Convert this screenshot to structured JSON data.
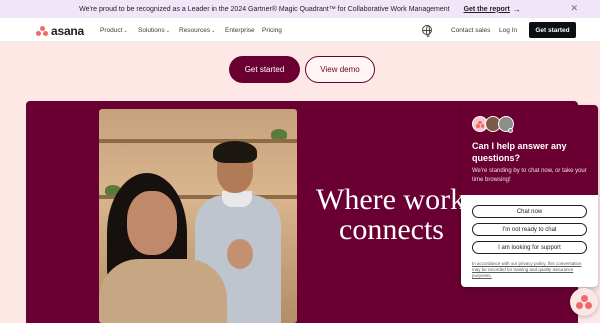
{
  "banner": {
    "text": "We're proud to be recognized as a Leader in the 2024 Gartner® Magic Quadrant™ for Collaborative Work Management",
    "link": "Get the report",
    "arrow": "→",
    "close": "✕"
  },
  "nav": {
    "logo": "asana",
    "items": [
      {
        "label": "Product",
        "chevron": "⌄"
      },
      {
        "label": "Solutions",
        "chevron": "⌄"
      },
      {
        "label": "Resources",
        "chevron": "⌄"
      },
      {
        "label": "Enterprise"
      },
      {
        "label": "Pricing"
      }
    ],
    "contact_sales": "Contact sales",
    "log_in": "Log In",
    "get_started": "Get started"
  },
  "cta": {
    "primary": "Get started",
    "secondary": "View demo"
  },
  "hero": {
    "headline_line1": "Where work",
    "headline_line2": "connects"
  },
  "chat": {
    "title": "Can I help answer any questions?",
    "subtitle": "We're standing by to chat now, or take your time browsing!",
    "buttons": [
      "Chat now",
      "I'm not ready to chat",
      "I am looking for support"
    ],
    "legal": "In accordance with our privacy policy, this conversation may be recorded for training and quality assurance purposes."
  },
  "colors": {
    "brand": "#690031",
    "accent": "#f06a6a",
    "background": "#fde8e6",
    "banner": "#f1e6f7"
  },
  "icons": {
    "logo": "asana-logo-dots",
    "globe": "globe-icon",
    "close": "close-icon",
    "launcher": "chat-launcher-icon"
  }
}
